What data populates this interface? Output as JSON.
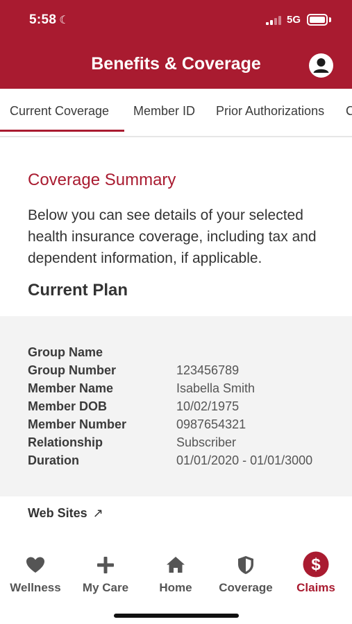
{
  "status_bar": {
    "time": "5:58",
    "network": "5G"
  },
  "header": {
    "title": "Benefits & Coverage"
  },
  "tabs": [
    {
      "label": "Current Coverage",
      "active": true
    },
    {
      "label": "Member ID",
      "active": false
    },
    {
      "label": "Prior Authorizations",
      "active": false
    },
    {
      "label": "C",
      "active": false
    }
  ],
  "summary": {
    "heading": "Coverage Summary",
    "description": "Below you can see details of your selected health insurance coverage, including tax and dependent information, if applicable.",
    "plan_heading": "Current Plan"
  },
  "plan_details": [
    {
      "label": "Group Name",
      "value": ""
    },
    {
      "label": "Group Number",
      "value": "123456789"
    },
    {
      "label": "Member Name",
      "value": "Isabella Smith"
    },
    {
      "label": "Member DOB",
      "value": "10/02/1975"
    },
    {
      "label": "Member Number",
      "value": "0987654321"
    },
    {
      "label": "Relationship",
      "value": "Subscriber"
    },
    {
      "label": "Duration",
      "value": "01/01/2020 - 01/01/3000"
    }
  ],
  "websites": {
    "label": "Web Sites",
    "arrow": "↗"
  },
  "tabbar": [
    {
      "label": "Wellness",
      "icon": "heart-icon",
      "active": false
    },
    {
      "label": "My Care",
      "icon": "plus-icon",
      "active": false
    },
    {
      "label": "Home",
      "icon": "home-icon",
      "active": false
    },
    {
      "label": "Coverage",
      "icon": "shield-icon",
      "active": false
    },
    {
      "label": "Claims",
      "icon": "dollar-icon",
      "active": true
    }
  ],
  "colors": {
    "brand": "#a91b30",
    "panel": "#f3f3f3"
  }
}
